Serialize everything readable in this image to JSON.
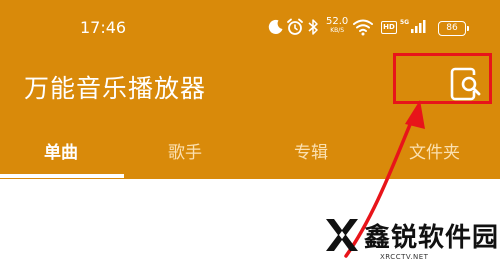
{
  "status_bar": {
    "time": "17:46",
    "net_speed_value": "52.0",
    "net_speed_unit": "KB/S",
    "hd_badge": "HD",
    "signal_label": "5G",
    "battery": "86",
    "icons": [
      "moon-icon",
      "alarm-icon",
      "bluetooth-icon",
      "wifi-icon",
      "signal-icon"
    ]
  },
  "header": {
    "title": "万能音乐播放器",
    "search_icon": "search-icon",
    "accent_color": "#d98a0a"
  },
  "tabs": [
    {
      "label": "单曲",
      "active": true
    },
    {
      "label": "歌手",
      "active": false
    },
    {
      "label": "专辑",
      "active": false
    },
    {
      "label": "文件夹",
      "active": false
    }
  ],
  "annotation": {
    "highlight_color": "#e8141a"
  },
  "watermark": {
    "name": "鑫锐软件园",
    "url": "XRCCTV.NET"
  }
}
